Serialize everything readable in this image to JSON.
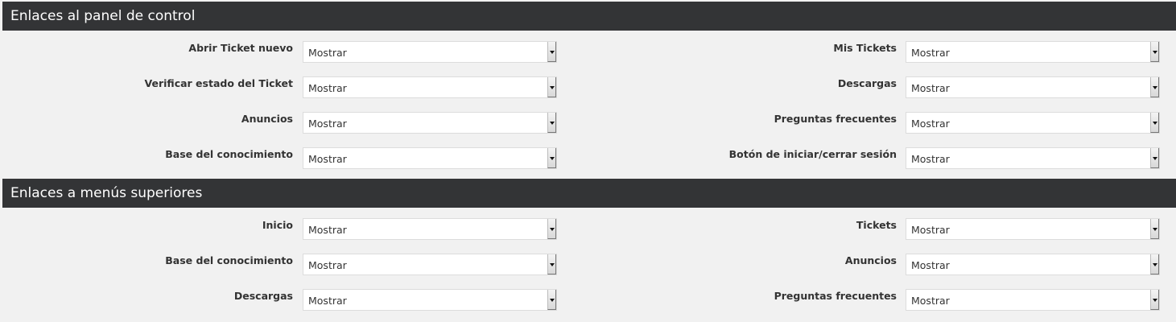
{
  "sections": [
    {
      "title": "Enlaces al panel de control",
      "rows": [
        {
          "left": {
            "label": "Abrir Ticket nuevo",
            "value": "Mostrar"
          },
          "right": {
            "label": "Mis Tickets",
            "value": "Mostrar"
          }
        },
        {
          "left": {
            "label": "Verificar estado del Ticket",
            "value": "Mostrar"
          },
          "right": {
            "label": "Descargas",
            "value": "Mostrar"
          }
        },
        {
          "left": {
            "label": "Anuncios",
            "value": "Mostrar"
          },
          "right": {
            "label": "Preguntas frecuentes",
            "value": "Mostrar"
          }
        },
        {
          "left": {
            "label": "Base del conocimiento",
            "value": "Mostrar"
          },
          "right": {
            "label": "Botón de iniciar/cerrar sesión",
            "value": "Mostrar"
          }
        }
      ]
    },
    {
      "title": "Enlaces a menús superiores",
      "rows": [
        {
          "left": {
            "label": "Inicio",
            "value": "Mostrar"
          },
          "right": {
            "label": "Tickets",
            "value": "Mostrar"
          }
        },
        {
          "left": {
            "label": "Base del conocimiento",
            "value": "Mostrar"
          },
          "right": {
            "label": "Anuncios",
            "value": "Mostrar"
          }
        },
        {
          "left": {
            "label": "Descargas",
            "value": "Mostrar"
          },
          "right": {
            "label": "Preguntas frecuentes",
            "value": "Mostrar"
          }
        }
      ]
    }
  ]
}
